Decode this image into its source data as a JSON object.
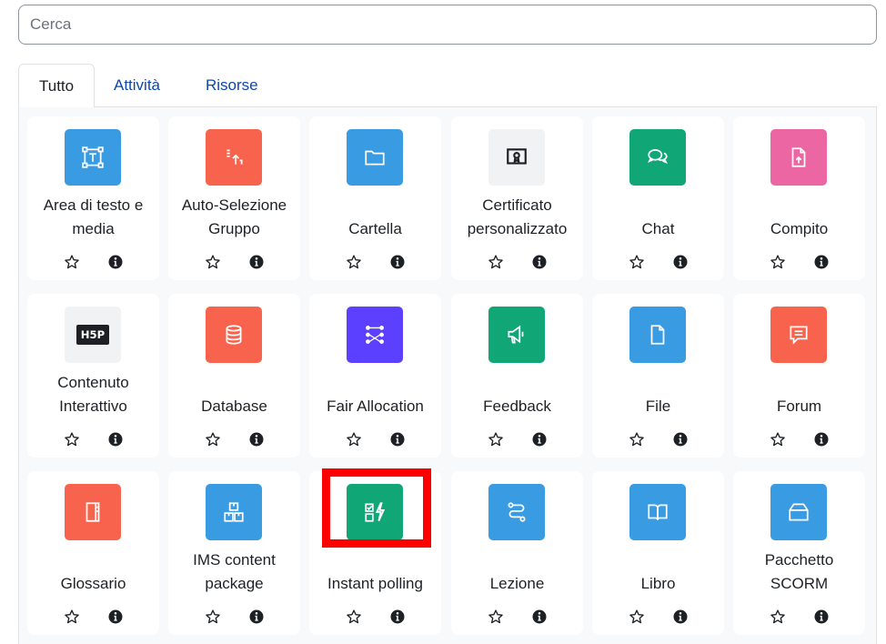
{
  "search": {
    "placeholder": "Cerca",
    "value": ""
  },
  "tabs": [
    {
      "label": "Tutto",
      "active": true
    },
    {
      "label": "Attività",
      "active": false
    },
    {
      "label": "Risorse",
      "active": false
    }
  ],
  "colors": {
    "blue": "#399be2",
    "red": "#f7634d",
    "green": "#11a676",
    "pink": "#eb66a2",
    "purple": "#5b40ff",
    "highlight": "#ff0000"
  },
  "modules": [
    {
      "line1": "Area di testo e",
      "line2": "media",
      "icon": "text-media-icon",
      "color": "#399be2"
    },
    {
      "line1": "Auto-Selezione",
      "line2": "Gruppo",
      "icon": "group-selection-icon",
      "color": "#f7634d"
    },
    {
      "line1": "",
      "line2": "Cartella",
      "icon": "folder-icon",
      "color": "#399be2"
    },
    {
      "line1": "Certificato",
      "line2": "personalizzato",
      "icon": "certificate-icon",
      "color": ""
    },
    {
      "line1": "",
      "line2": "Chat",
      "icon": "chat-icon",
      "color": "#11a676"
    },
    {
      "line1": "",
      "line2": "Compito",
      "icon": "assignment-icon",
      "color": "#eb66a2"
    },
    {
      "line1": "Contenuto",
      "line2": "Interattivo",
      "icon": "h5p-icon",
      "color": ""
    },
    {
      "line1": "",
      "line2": "Database",
      "icon": "database-icon",
      "color": "#f7634d"
    },
    {
      "line1": "",
      "line2": "Fair Allocation",
      "icon": "fair-allocation-icon",
      "color": "#5b40ff"
    },
    {
      "line1": "",
      "line2": "Feedback",
      "icon": "megaphone-icon",
      "color": "#11a676"
    },
    {
      "line1": "",
      "line2": "File",
      "icon": "file-icon",
      "color": "#399be2"
    },
    {
      "line1": "",
      "line2": "Forum",
      "icon": "forum-icon",
      "color": "#f7634d"
    },
    {
      "line1": "",
      "line2": "Glossario",
      "icon": "glossary-icon",
      "color": "#f7634d"
    },
    {
      "line1": "IMS content",
      "line2": "package",
      "icon": "ims-package-icon",
      "color": "#399be2"
    },
    {
      "line1": "",
      "line2": "Instant polling",
      "icon": "instant-polling-icon",
      "color": "#11a676"
    },
    {
      "line1": "",
      "line2": "Lezione",
      "icon": "lesson-icon",
      "color": "#399be2"
    },
    {
      "line1": "",
      "line2": "Libro",
      "icon": "book-icon",
      "color": "#399be2"
    },
    {
      "line1": "Pacchetto",
      "line2": "SCORM",
      "icon": "scorm-icon",
      "color": "#399be2"
    }
  ],
  "h5p_logo_text": "H5P"
}
